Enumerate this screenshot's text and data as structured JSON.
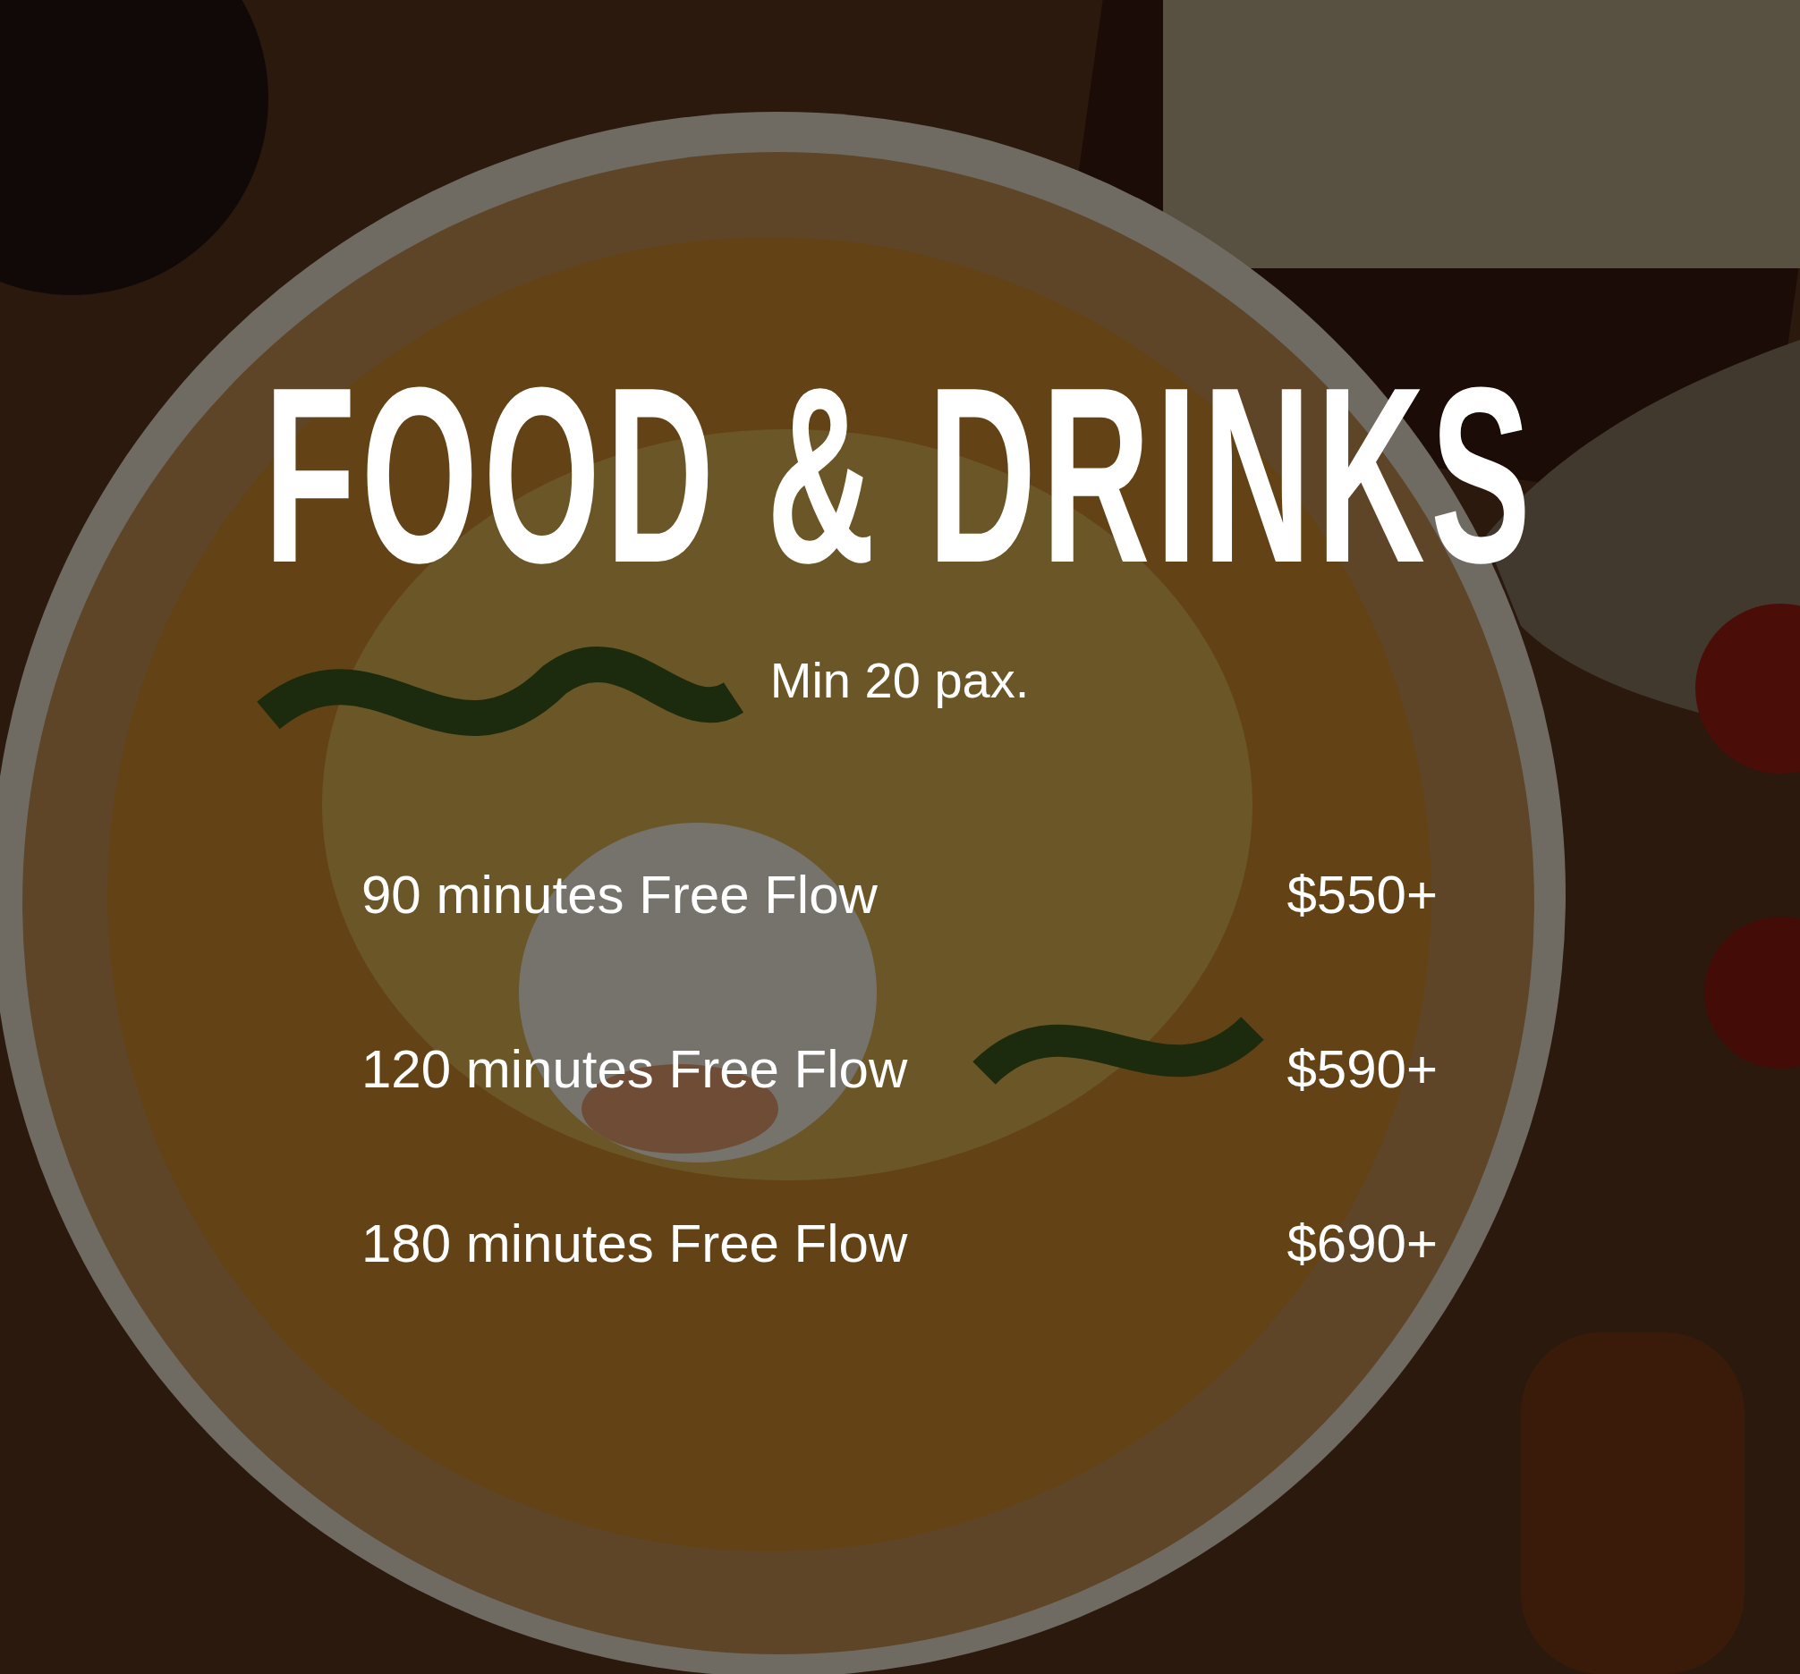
{
  "title": "FOOD & DRINKS",
  "subtitle": "Min 20 pax.",
  "packages": [
    {
      "name": "90 minutes Free Flow",
      "price": "$550+"
    },
    {
      "name": "120 minutes Free Flow",
      "price": "$590+"
    },
    {
      "name": "180 minutes Free Flow",
      "price": "$690+"
    }
  ]
}
